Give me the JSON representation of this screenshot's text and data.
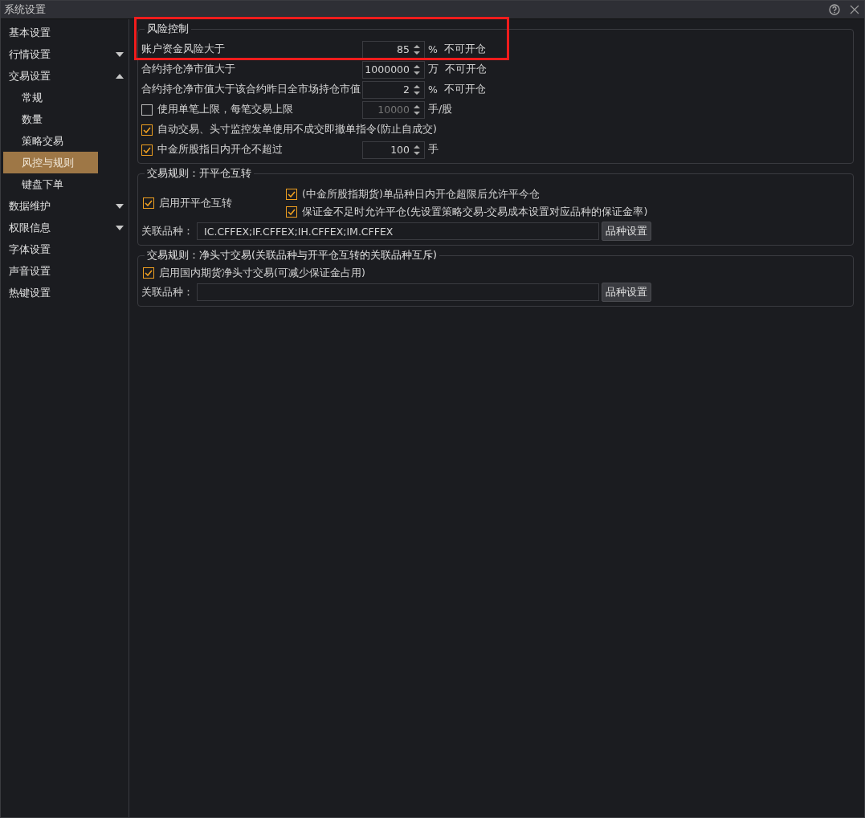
{
  "window": {
    "title": "系统设置"
  },
  "sidebar": {
    "items": [
      {
        "label": "基本设置",
        "selected": false
      },
      {
        "label": "行情设置",
        "selected": false,
        "expanded": false
      },
      {
        "label": "交易设置",
        "selected": false,
        "expanded": true,
        "children": [
          {
            "label": "常规",
            "selected": false
          },
          {
            "label": "数量",
            "selected": false
          },
          {
            "label": "策略交易",
            "selected": false
          },
          {
            "label": "风控与规则",
            "selected": true
          },
          {
            "label": "键盘下单",
            "selected": false
          }
        ]
      },
      {
        "label": "数据维护",
        "selected": false,
        "expanded": false
      },
      {
        "label": "权限信息",
        "selected": false,
        "expanded": false
      },
      {
        "label": "字体设置",
        "selected": false
      },
      {
        "label": "声音设置",
        "selected": false
      },
      {
        "label": "热键设置",
        "selected": false
      }
    ]
  },
  "risk_control": {
    "title": "风险控制",
    "highlighted": true,
    "rows": [
      {
        "kind": "spin",
        "label": "账户资金风险大于",
        "value": "85",
        "disabled": false,
        "unit": "%",
        "suffix": "不可开仓"
      },
      {
        "kind": "spin",
        "label": "合约持仓净市值大于",
        "value": "1000000",
        "disabled": false,
        "unit": "万",
        "suffix": "不可开仓"
      },
      {
        "kind": "spin",
        "label": "合约持仓净市值大于该合约昨日全市场持仓市值",
        "value": "2",
        "disabled": false,
        "unit": "%",
        "suffix": "不可开仓"
      },
      {
        "kind": "check-spin",
        "label": "使用单笔上限，每笔交易上限",
        "checked": false,
        "value": "10000",
        "disabled": true,
        "unit": "手/股"
      },
      {
        "kind": "check",
        "label": "自动交易、头寸监控发单使用不成交即撤单指令(防止自成交)",
        "checked": true
      },
      {
        "kind": "check-spin",
        "label": "中金所股指日内开仓不超过",
        "checked": true,
        "value": "100",
        "disabled": false,
        "unit": "手"
      }
    ]
  },
  "open_close_switch": {
    "title": "交易规则：开平仓互转",
    "enable": {
      "label": "启用开平仓互转",
      "checked": true
    },
    "options": [
      {
        "label": "(中金所股指期货)单品种日内开仓超限后允许平今仓",
        "checked": true
      },
      {
        "label": "保证金不足时允许平仓(先设置策略交易-交易成本设置对应品种的保证金率)",
        "checked": true
      }
    ],
    "related": {
      "label": "关联品种：",
      "value": "IC.CFFEX;IF.CFFEX;IH.CFFEX;IM.CFFEX",
      "button": "品种设置"
    }
  },
  "net_position": {
    "title": "交易规则：净头寸交易(关联品种与开平仓互转的关联品种互斥)",
    "enable": {
      "label": "启用国内期货净头寸交易(可减少保证金占用)",
      "checked": true
    },
    "related": {
      "label": "关联品种：",
      "button": "品种设置"
    }
  }
}
